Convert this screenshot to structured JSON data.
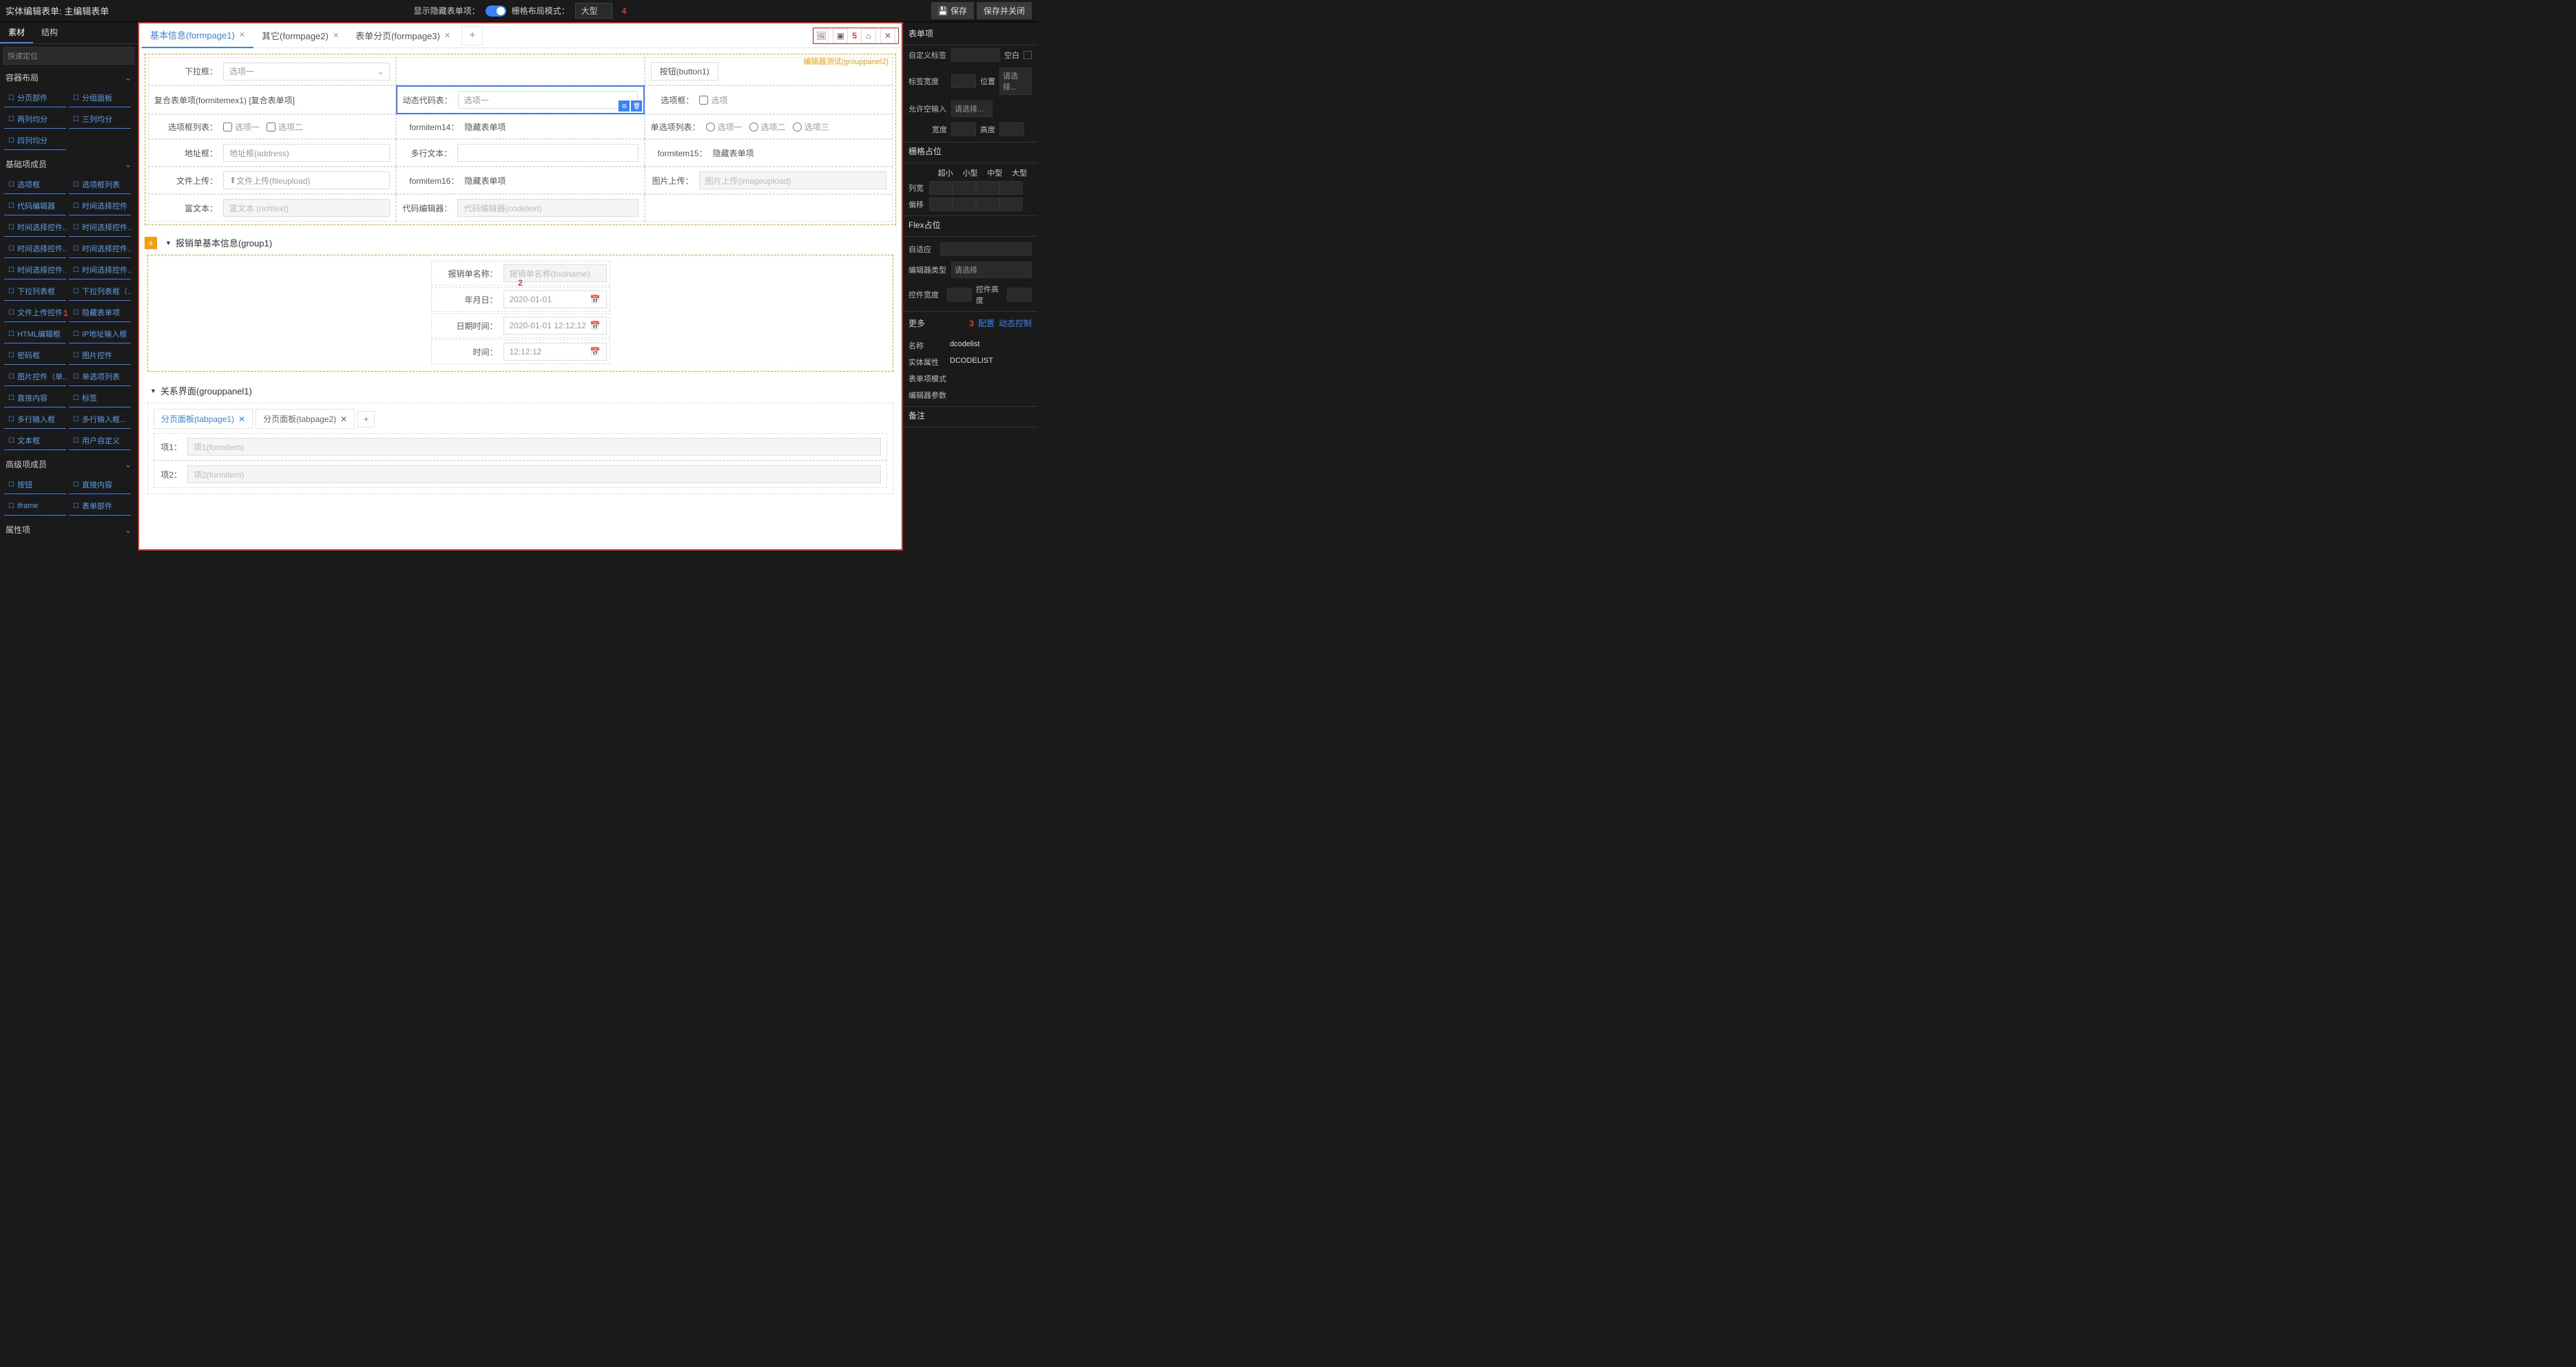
{
  "top": {
    "title": "实体编辑表单: 主编辑表单",
    "show_hidden_label": "显示隐藏表单项：",
    "grid_mode_label": "栅格布局模式：",
    "grid_mode_value": "大型",
    "marker4": "4",
    "save": "保存",
    "save_close": "保存并关闭"
  },
  "left": {
    "tab_material": "素材",
    "tab_structure": "结构",
    "search_placeholder": "快速定位",
    "sections": {
      "container": {
        "title": "容器布局",
        "items": [
          "分页部件",
          "分组面板",
          "两列均分",
          "三列均分",
          "四列均分"
        ]
      },
      "basic": {
        "title": "基础项成员",
        "items": [
          "选项框",
          "选项框列表",
          "代码编辑器",
          "时间选择控件",
          "时间选择控件...",
          "时间选择控件...",
          "时间选择控件...",
          "时间选择控件...",
          "时间选择控件...",
          "时间选择控件...",
          "下拉列表框",
          "下拉列表框（...",
          "文件上传控件",
          "隐藏表单项",
          "HTML编辑框",
          "IP地址输入框",
          "密码框",
          "图片控件",
          "图片控件（单...",
          "单选项列表",
          "直接内容",
          "标签",
          "多行输入框",
          "多行输入框...",
          "文本框",
          "用户自定义"
        ]
      },
      "advanced": {
        "title": "高级项成员",
        "items": [
          "按钮",
          "直接内容",
          "iframe",
          "表单部件"
        ]
      },
      "attr": {
        "title": "属性项"
      }
    },
    "marker1": "1"
  },
  "center": {
    "tabs": [
      {
        "label": "基本信息(formpage1)",
        "active": true
      },
      {
        "label": "其它(formpage2)",
        "active": false
      },
      {
        "label": "表单分页(formpage3)",
        "active": false
      }
    ],
    "marker5": "5",
    "group_label": "编辑器测试(grouppanel2)",
    "dropdown_label": "下拉框：",
    "dropdown_value": "选项一",
    "button_label": "按钮(button1)",
    "composite_label": "复合表单项(formitemex1) [复合表单项]",
    "dynamic_code_label": "动态代码表：",
    "dynamic_code_value": "选项一",
    "option_box_label": "选项框：",
    "option_box_value": "选项",
    "option_list_label": "选项框列表：",
    "option_list_v1": "选项一",
    "option_list_v2": "选项二",
    "formitem14_label": "formitem14：",
    "formitem14_value": "隐藏表单项",
    "radio_list_label": "单选项列表：",
    "radio_v1": "选项一",
    "radio_v2": "选项二",
    "radio_v3": "选项三",
    "address_label": "地址框：",
    "address_ph": "地址框(address)",
    "multiline_label": "多行文本：",
    "formitem15_label": "formitem15：",
    "formitem15_value": "隐藏表单项",
    "file_upload_label": "文件上传：",
    "file_upload_btn": "文件上传(fileupload)",
    "formitem16_label": "formitem16：",
    "formitem16_value": "隐藏表单项",
    "image_upload_label": "图片上传：",
    "image_upload_ph": "图片上传(imageupload)",
    "richtext_label": "富文本：",
    "richtext_ph": "富文本 (richtext)",
    "code_editor_label": "代码编辑器：",
    "code_editor_ph": "代码编辑器(codetext)",
    "group1_title": "报销单基本信息(group1)",
    "marker2": "2",
    "bxd_name_label": "报销单名称：",
    "bxd_name_ph": "报销单名称(bxdname)",
    "ymd_label": "年月日：",
    "ymd_value": "2020-01-01",
    "datetime_label": "日期时间：",
    "datetime_value": "2020-01-01 12:12:12",
    "time_label": "时间：",
    "time_value": "12:12:12",
    "group2_title": "关系界面(grouppanel1)",
    "inner_tabs": [
      {
        "label": "分页面板(tabpage1)",
        "active": true
      },
      {
        "label": "分页面板(tabpage2)",
        "active": false
      }
    ],
    "item1_label": "项1：",
    "item1_ph": "项1(formitem)",
    "item2_label": "项2：",
    "item2_ph": "项2(formitem)"
  },
  "right": {
    "header": "表单项",
    "custom_label": "自定义标签",
    "blank": "空白",
    "label_width": "标签宽度",
    "position": "位置",
    "select_ph": "请选择...",
    "allow_empty": "允许空输入",
    "width": "宽度",
    "height": "高度",
    "grid_title": "栅格占位",
    "cols": [
      "超小",
      "小型",
      "中型",
      "大型"
    ],
    "col_width": "列宽",
    "offset": "偏移",
    "flex_title": "Flex占位",
    "adaptive": "自适应",
    "editor_type": "编辑器类型",
    "editor_type_ph": "请选择",
    "ctrl_width": "控件宽度",
    "ctrl_height": "控件高度",
    "more": "更多",
    "marker3": "3",
    "config": "配置",
    "dynamic_ctrl": "动态控制",
    "name_label": "名称",
    "name_value": "dcodelist",
    "entity_attr_label": "实体属性",
    "entity_attr_value": "DCODELIST",
    "form_item_mode": "表单项模式",
    "editor_params": "编辑器参数",
    "remark": "备注"
  }
}
